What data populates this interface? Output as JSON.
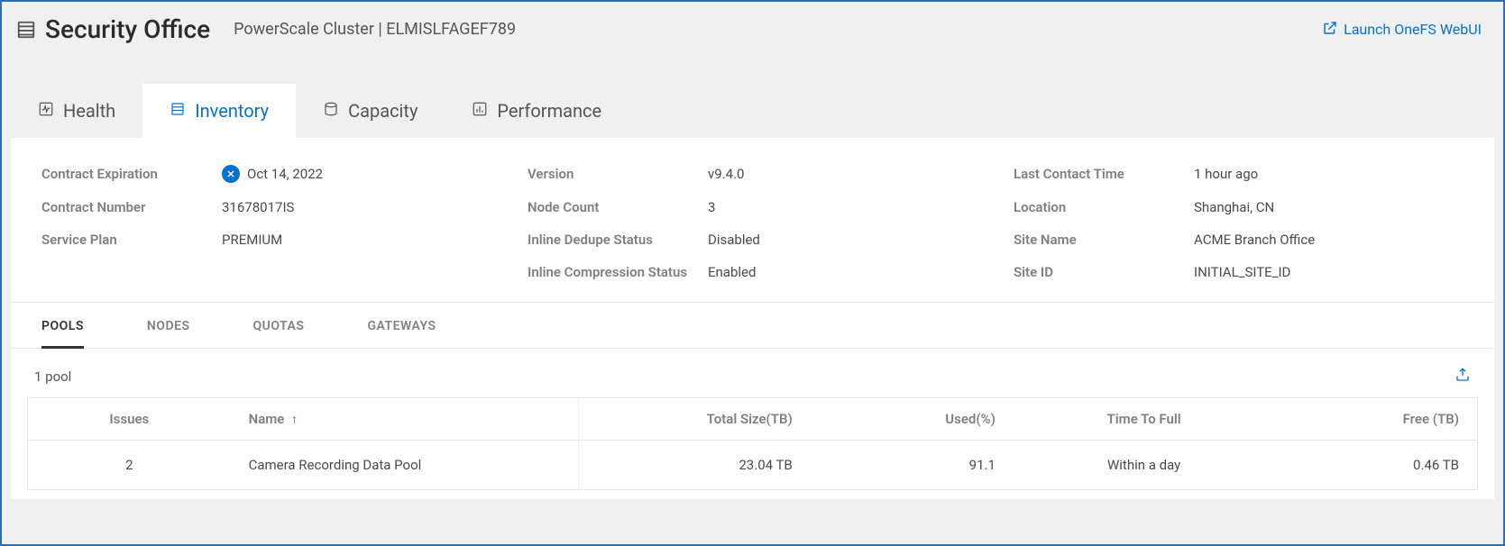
{
  "header": {
    "title": "Security Office",
    "subtitle": "PowerScale Cluster | ELMISLFAGEF789",
    "launch_label": "Launch OneFS WebUI"
  },
  "tabs": {
    "health": "Health",
    "inventory": "Inventory",
    "capacity": "Capacity",
    "performance": "Performance"
  },
  "props": {
    "contract_expiration_label": "Contract Expiration",
    "contract_expiration_value": "Oct 14, 2022",
    "contract_number_label": "Contract Number",
    "contract_number_value": "31678017IS",
    "service_plan_label": "Service Plan",
    "service_plan_value": "PREMIUM",
    "version_label": "Version",
    "version_value": "v9.4.0",
    "node_count_label": "Node Count",
    "node_count_value": "3",
    "inline_dedupe_label": "Inline Dedupe Status",
    "inline_dedupe_value": "Disabled",
    "inline_compression_label": "Inline Compression Status",
    "inline_compression_value": "Enabled",
    "last_contact_label": "Last Contact Time",
    "last_contact_value": "1 hour ago",
    "location_label": "Location",
    "location_value": "Shanghai, CN",
    "site_name_label": "Site Name",
    "site_name_value": "ACME Branch Office",
    "site_id_label": "Site ID",
    "site_id_value": "INITIAL_SITE_ID"
  },
  "subtabs": {
    "pools": "POOLS",
    "nodes": "NODES",
    "quotas": "QUOTAS",
    "gateways": "GATEWAYS"
  },
  "table": {
    "summary": "1 pool",
    "columns": {
      "issues": "Issues",
      "name": "Name",
      "total_size": "Total Size(TB)",
      "used": "Used(%)",
      "time_to_full": "Time To Full",
      "free": "Free (TB)"
    },
    "rows": [
      {
        "issues": "2",
        "name": "Camera Recording Data Pool",
        "total_size": "23.04 TB",
        "used": "91.1",
        "time_to_full": "Within a day",
        "free": "0.46 TB"
      }
    ]
  }
}
